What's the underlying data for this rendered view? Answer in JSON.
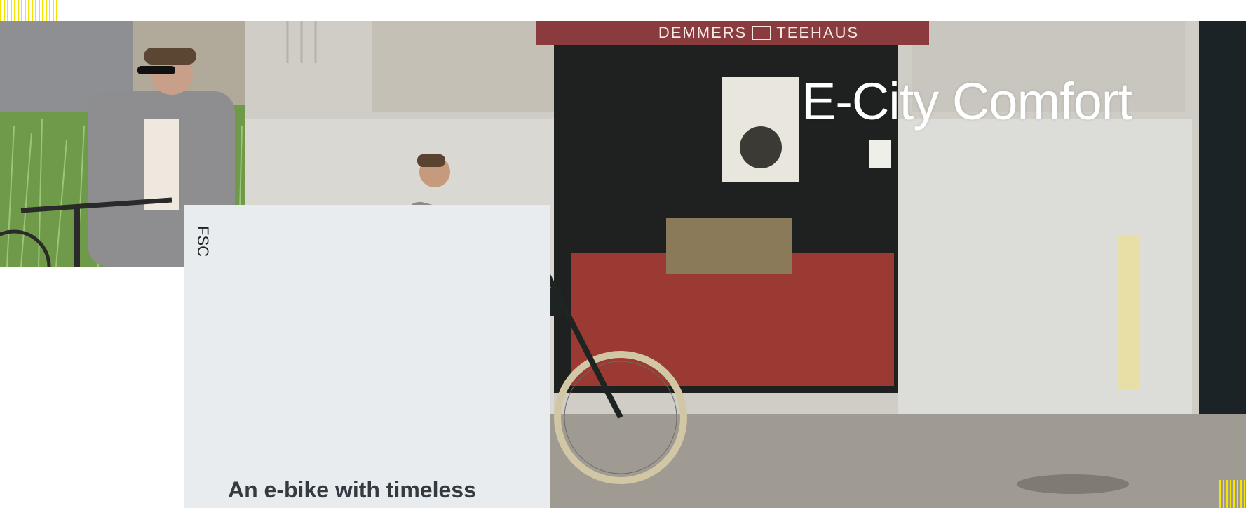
{
  "hero": {
    "title": "E-City Comfort",
    "shop_sign_left": "DEMMERS",
    "shop_sign_right": "TEEHAUS"
  },
  "card": {
    "tag": "FSC",
    "description": "An e-bike with timeless"
  },
  "colors": {
    "accent_yellow": "#f5e400",
    "card_background": "#e8ecef",
    "awning": "#8a3b3e",
    "text_dark": "#333a40"
  }
}
